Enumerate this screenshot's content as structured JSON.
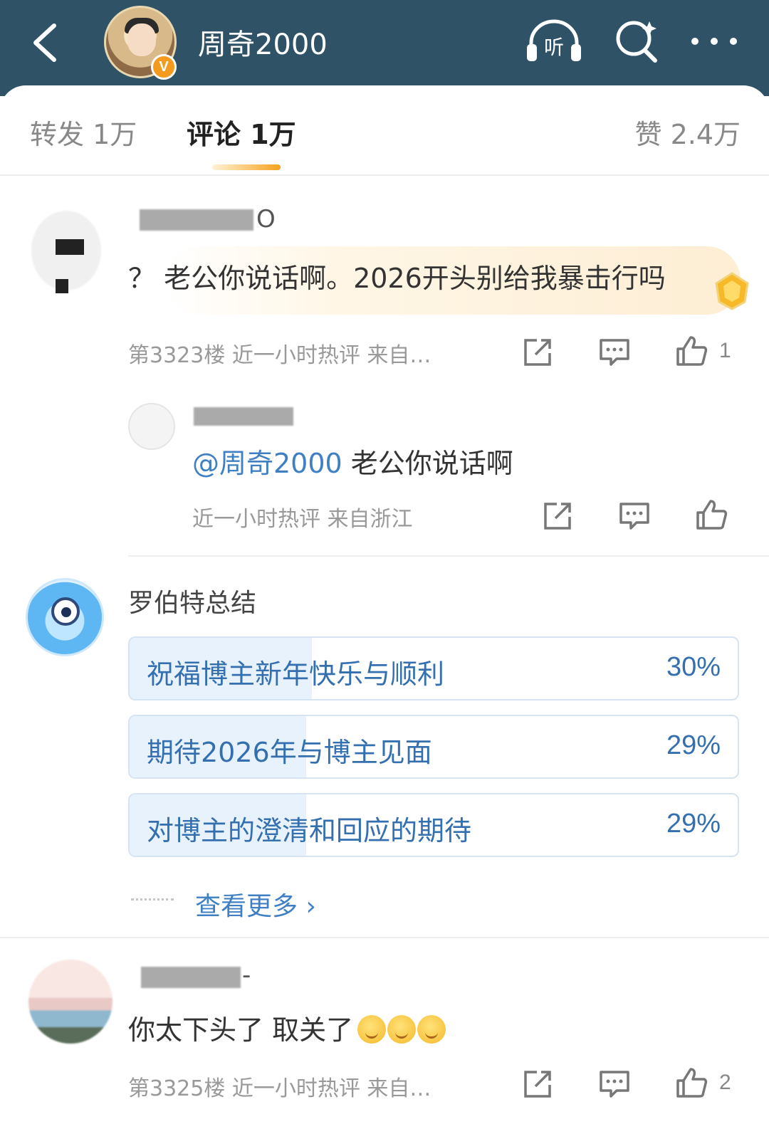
{
  "header": {
    "title": "周奇2000",
    "verified_badge": "V",
    "listen_label": "听",
    "colors": {
      "bar": "#2f5267",
      "verified": "#f39a1f"
    }
  },
  "tabs": [
    {
      "label": "转发 1万",
      "active": false
    },
    {
      "label": "评论 1万",
      "active": true
    },
    {
      "label": "赞 2.4万",
      "active": false
    }
  ],
  "comments": [
    {
      "username_visible": "O",
      "text": "？ 老公你说话啊。2026开头别给我暴击行吗",
      "meta": "第3323楼  近一小时热评  来自…",
      "like_count": "1",
      "reply": {
        "text_at": "@周奇2000",
        "text_body": " 老公你说话啊",
        "meta": "近一小时热评  来自浙江"
      }
    },
    {
      "username": "罗伯特总结",
      "poll": [
        {
          "label": "祝福博主新年快乐与顺利",
          "pct": "30%",
          "value": 0.3
        },
        {
          "label": "期待2026年与博主见面",
          "pct": "29%",
          "value": 0.29
        },
        {
          "label": "对博主的澄清和回应的期待",
          "pct": "29%",
          "value": 0.29
        }
      ],
      "see_more": "查看更多 ›"
    },
    {
      "username_visible": "-",
      "text": "你太下头了 取关了",
      "meta": "第3325楼  近一小时热评  来自…",
      "like_count": "2"
    }
  ]
}
